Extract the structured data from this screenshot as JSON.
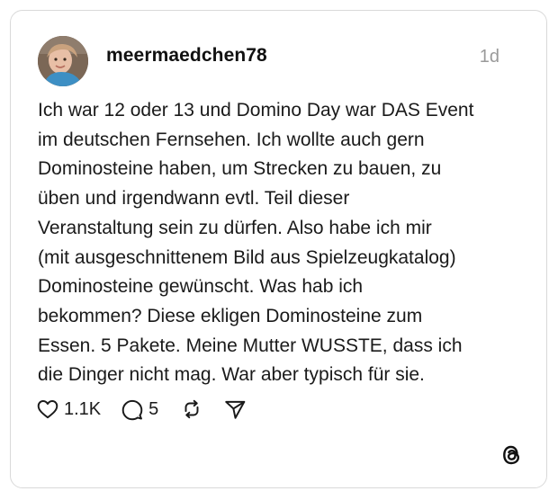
{
  "post": {
    "username": "meermaedchen78",
    "time": "1d",
    "text_lines": [
      "Ich war 12 oder 13 und Domino Day war DAS Event",
      "im deutschen Fernsehen. Ich wollte auch gern",
      "Dominosteine haben, um Strecken zu bauen, zu",
      "üben und irgendwann evtl. Teil dieser",
      "Veranstaltung sein zu dürfen. Also habe ich mir",
      "(mit ausgeschnittenem Bild aus Spielzeugkatalog)",
      "Dominosteine gewünscht. Was hab ich",
      "bekommen? Diese ekligen Dominosteine zum",
      "Essen. 5 Pakete. Meine Mutter WUSSTE, dass ich",
      "die Dinger nicht mag. War aber typisch für sie."
    ]
  },
  "actions": {
    "like_icon": "heart-icon",
    "like_count": "1.1K",
    "reply_icon": "comment-icon",
    "reply_count": "5",
    "repost_icon": "repost-icon",
    "share_icon": "send-icon"
  },
  "branding": {
    "logo": "threads-logo-icon"
  },
  "colors": {
    "background": "#ffffff",
    "border": "#d9d9d9",
    "text": "#1a1a1a",
    "muted": "#9a9a9a"
  }
}
